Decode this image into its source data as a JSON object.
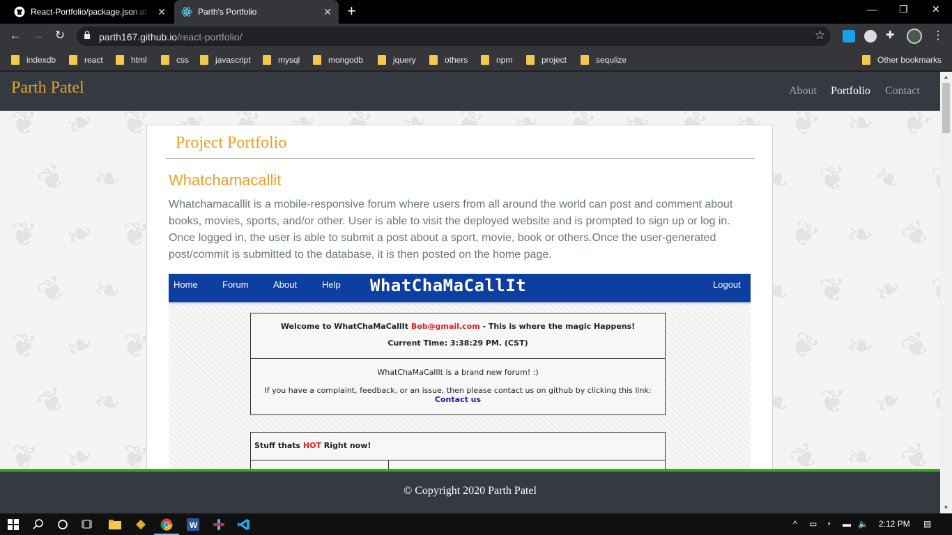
{
  "browser": {
    "tabs": [
      {
        "title": "React-Portfolio/package.json at master · parth167/React-Portfolio",
        "icon": "github-icon",
        "active": false
      },
      {
        "title": "Parth's Portfolio",
        "icon": "react-icon",
        "active": true
      }
    ],
    "url_host": "parth167.github.io",
    "url_path": "/react-portfolio/",
    "bookmarks": [
      "indexdb",
      "react",
      "html",
      "css",
      "javascript",
      "mysql",
      "mongodb",
      "jquery",
      "others",
      "npm",
      "project",
      "sequlize"
    ],
    "other_bookmarks": "Other bookmarks"
  },
  "site": {
    "brand": "Parth Patel",
    "nav": [
      {
        "label": "About",
        "active": false
      },
      {
        "label": "Portfolio",
        "active": true
      },
      {
        "label": "Contact",
        "active": false
      }
    ],
    "section_title": "Project Portfolio",
    "project": {
      "title": "Whatchamacallit",
      "description": "Whatchamacallit is a mobile-responsive forum where users from all around the world can post and comment about books, movies, sports, and/or other. User is able to visit the deployed website and is prompted to sign up or log in. Once logged in, the user is able to submit a post about a sport, movie, book or others.Once the user-generated post/commit is submitted to the database, it is then posted on the home page."
    },
    "screenshot": {
      "nav": [
        "Home",
        "Forum",
        "About",
        "Help"
      ],
      "logo": "WhatChaMaCallIt",
      "logout": "Logout",
      "welcome_prefix": "Welcome to WhatChaMaCallIt ",
      "welcome_email": "Bob@gmail.com",
      "welcome_suffix": " - This is where the magic Happens!",
      "time": "Current Time: 3:38:29 PM. (CST)",
      "intro": "WhatChaMaCallIt is a brand new forum! :)",
      "complaint": "If you have a complaint, feedback, or an issue, then please contact us on github by clicking this link:",
      "contact_link": "Contact us",
      "hot_prefix": "Stuff thats ",
      "hot_word": "HOT",
      "hot_suffix": " Right now!"
    },
    "footer": "© Copyright 2020 Parth Patel"
  },
  "taskbar": {
    "time": "2:12 PM"
  },
  "colors": {
    "accent": "#e9a126",
    "navbar": "#343a40",
    "footer_border": "#2fae1a",
    "shot_nav": "#0d3fa0"
  }
}
